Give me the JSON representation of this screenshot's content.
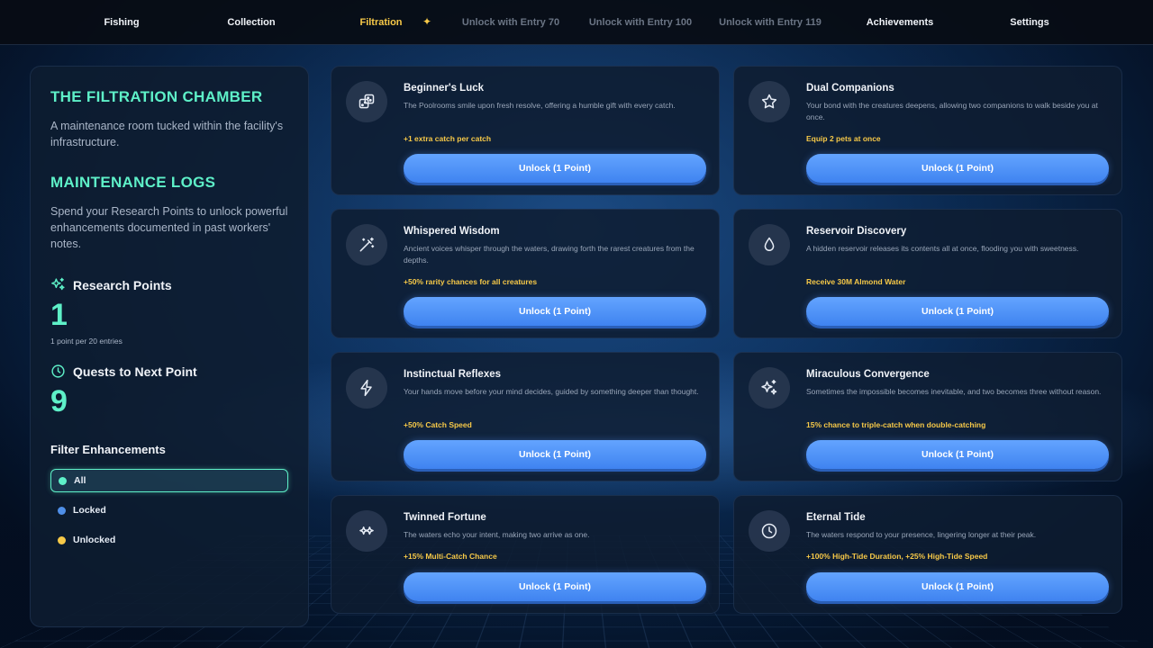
{
  "nav": {
    "tabs": [
      {
        "label": "Fishing"
      },
      {
        "label": "Collection"
      },
      {
        "label": "Filtration"
      },
      {
        "label": "Unlock with Entry 70"
      },
      {
        "label": "Unlock with Entry 100"
      },
      {
        "label": "Unlock with Entry 119"
      },
      {
        "label": "Achievements"
      },
      {
        "label": "Settings"
      }
    ],
    "active_tab": "Filtration",
    "spark_icon": "sparkle-icon"
  },
  "sidebar": {
    "title": "THE FILTRATION CHAMBER",
    "description": "A maintenance room tucked within the facility's infrastructure.",
    "logs_title": "MAINTENANCE LOGS",
    "logs_description": "Spend your Research Points to unlock powerful enhancements documented in past workers' notes.",
    "research_label": "Research Points",
    "research_value": "1",
    "research_sub": "1 point per 20 entries",
    "quests_label": "Quests to Next Point",
    "quests_value": "9",
    "filter_title": "Filter Enhancements",
    "filters": [
      {
        "label": "All",
        "color": "#5ef0c8"
      },
      {
        "label": "Locked",
        "color": "#4f8fe8"
      },
      {
        "label": "Unlocked",
        "color": "#f7c948"
      }
    ],
    "active_filter": "All"
  },
  "cards": [
    {
      "title": "Beginner's Luck",
      "description": "The Poolrooms smile upon fresh resolve, offering a humble gift with every catch.",
      "effect": "+1 extra catch per catch",
      "button": "Unlock (1 Point)",
      "icon": "dice-icon"
    },
    {
      "title": "Dual Companions",
      "description": "Your bond with the creatures deepens, allowing two companions to walk beside you at once.",
      "effect": "Equip 2 pets at once",
      "button": "Unlock (1 Point)",
      "icon": "star-icon"
    },
    {
      "title": "Whispered Wisdom",
      "description": "Ancient voices whisper through the waters, drawing forth the rarest creatures from the depths.",
      "effect": "+50% rarity chances for all creatures",
      "button": "Unlock (1 Point)",
      "icon": "magic-wand-icon"
    },
    {
      "title": "Reservoir Discovery",
      "description": "A hidden reservoir releases its contents all at once, flooding you with sweetness.",
      "effect": "Receive 30M Almond Water",
      "button": "Unlock (1 Point)",
      "icon": "droplet-icon"
    },
    {
      "title": "Instinctual Reflexes",
      "description": "Your hands move before your mind decides, guided by something deeper than thought.",
      "effect": "+50% Catch Speed",
      "button": "Unlock (1 Point)",
      "icon": "lightning-icon"
    },
    {
      "title": "Miraculous Convergence",
      "description": "Sometimes the impossible becomes inevitable, and two becomes three without reason.",
      "effect": "15% chance to triple-catch when double-catching",
      "button": "Unlock (1 Point)",
      "icon": "sparkles-icon"
    },
    {
      "title": "Twinned Fortune",
      "description": "The waters echo your intent, making two arrive as one.",
      "effect": "+15% Multi-Catch Chance",
      "button": "Unlock (1 Point)",
      "icon": "twin-sparkle-icon"
    },
    {
      "title": "Eternal Tide",
      "description": "The waters respond to your presence, lingering longer at their peak.",
      "effect": "+100% High-Tide Duration, +25% High-Tide Speed",
      "button": "Unlock (1 Point)",
      "icon": "clock-icon"
    }
  ]
}
